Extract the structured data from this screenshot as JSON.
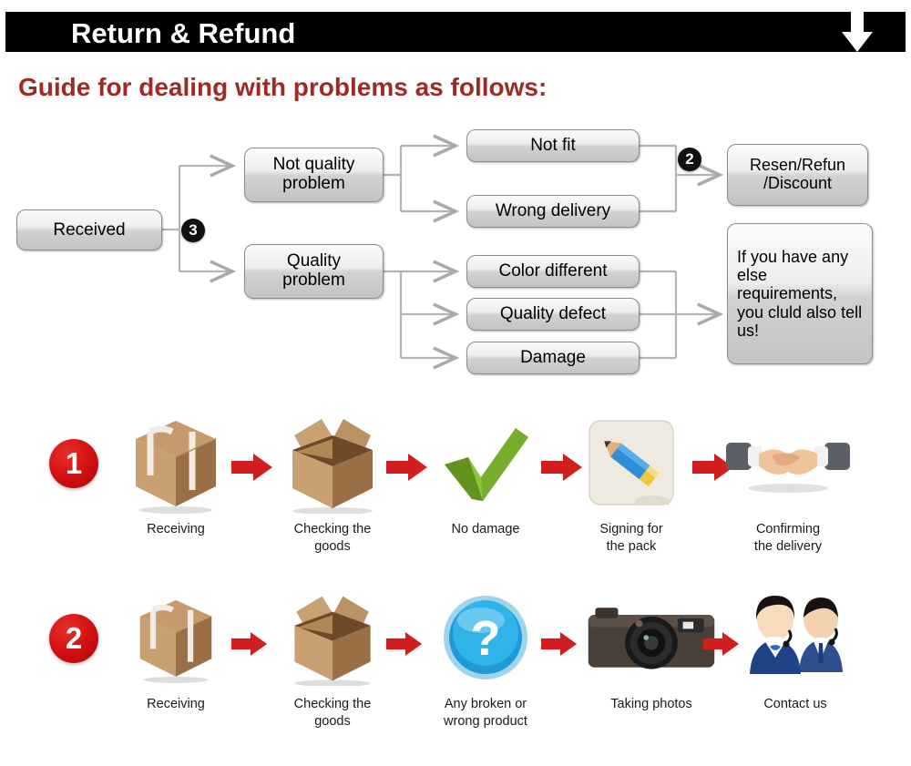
{
  "header": {
    "title": "Return & Refund",
    "arrow_icon": "down-arrow-icon",
    "bar_color": "#000000",
    "text_color": "#ffffff"
  },
  "guide": {
    "title": "Guide for dealing with problems as follows:",
    "color": "#9e2a26"
  },
  "flowchart": {
    "nodes": {
      "received": "Received",
      "not_quality": "Not quality\nproblem",
      "quality": "Quality\nproblem",
      "not_fit": "Not fit",
      "wrong_delivery": "Wrong delivery",
      "color_different": "Color different",
      "quality_defect": "Quality defect",
      "damage": "Damage",
      "resend": "Resen/Refun\n/Discount",
      "else_requirements": "If you have any else requirements, you cluld also tell us!"
    },
    "markers": {
      "branch_marker": "3",
      "outcome_marker": "2"
    }
  },
  "process": {
    "row1": {
      "number": "1",
      "steps": [
        {
          "icon": "sealed-box-icon",
          "label": "Receiving"
        },
        {
          "icon": "open-box-icon",
          "label": "Checking the\ngoods"
        },
        {
          "icon": "green-check-icon",
          "label": "No damage"
        },
        {
          "icon": "pencil-signing-icon",
          "label": "Signing for\nthe pack"
        },
        {
          "icon": "handshake-icon",
          "label": "Confirming\nthe delivery"
        }
      ]
    },
    "row2": {
      "number": "2",
      "steps": [
        {
          "icon": "sealed-box-icon",
          "label": "Receiving"
        },
        {
          "icon": "open-box-icon",
          "label": "Checking the\ngoods"
        },
        {
          "icon": "blue-question-mark-icon",
          "label": "Any broken or\nwrong product"
        },
        {
          "icon": "camera-icon",
          "label": "Taking photos"
        },
        {
          "icon": "support-agents-icon",
          "label": "Contact us"
        }
      ]
    },
    "arrow_icon": "red-right-arrow-icon",
    "arrow_color": "#d11f1f"
  }
}
